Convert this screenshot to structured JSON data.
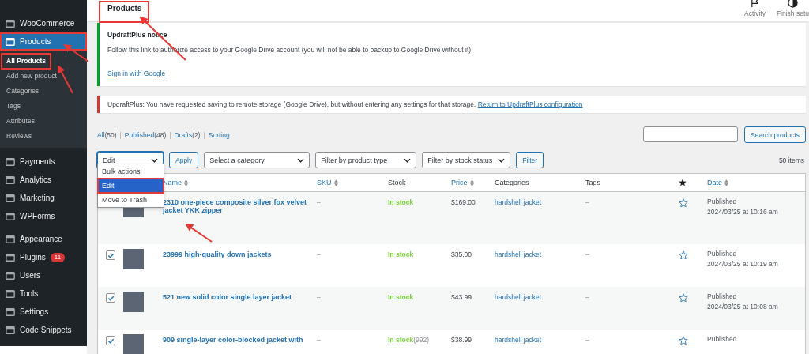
{
  "sidebar": {
    "groups": [
      {
        "items": [
          {
            "label": "WooCommerce",
            "selected": false,
            "annotated": false
          },
          {
            "label": "Products",
            "selected": true,
            "annotated": true,
            "children": [
              {
                "label": "All Products",
                "selected": true,
                "annotated": true
              },
              {
                "label": "Add new product",
                "selected": false,
                "annotated": false
              },
              {
                "label": "Categories",
                "selected": false,
                "annotated": false
              },
              {
                "label": "Tags",
                "selected": false,
                "annotated": false
              },
              {
                "label": "Attributes",
                "selected": false,
                "annotated": false
              },
              {
                "label": "Reviews",
                "selected": false,
                "annotated": false
              }
            ]
          }
        ]
      },
      {
        "items": [
          {
            "label": "Payments",
            "selected": false,
            "annotated": false
          },
          {
            "label": "Analytics",
            "selected": false,
            "annotated": false
          },
          {
            "label": "Marketing",
            "selected": false,
            "annotated": false
          },
          {
            "label": "WPForms",
            "selected": false,
            "annotated": false
          }
        ]
      },
      {
        "items": [
          {
            "label": "Appearance",
            "selected": false,
            "annotated": false
          },
          {
            "label": "Plugins",
            "selected": false,
            "annotated": false,
            "badge": "11"
          },
          {
            "label": "Users",
            "selected": false,
            "annotated": false
          },
          {
            "label": "Tools",
            "selected": false,
            "annotated": false
          },
          {
            "label": "Settings",
            "selected": false,
            "annotated": false
          },
          {
            "label": "Code Snippets",
            "selected": false,
            "annotated": false
          }
        ]
      }
    ]
  },
  "header": {
    "title": "Products",
    "title_annotated": true,
    "actions": [
      "Activity",
      "Finish setu"
    ]
  },
  "notices": [
    {
      "kind": "success",
      "title": "UpdraftPlus notice",
      "text": "Follow this link to authorize access to your Google Drive account (you will not be able to backup to Google Drive without it).",
      "link": "Sign in with Google"
    },
    {
      "kind": "error",
      "text": "UpdraftPlus: You have requested saving to remote storage (Google Drive), but without entering any settings for that storage.",
      "link": "Return to UpdraftPlus configuration"
    }
  ],
  "views": [
    {
      "label": "All",
      "count": "(50)"
    },
    {
      "separator_before": "|",
      "label": "Published",
      "count": "(48)"
    },
    {
      "separator_before": "|",
      "label": "Drafts",
      "count": "(2)"
    },
    {
      "separator_before": "|",
      "label": "Sorting"
    }
  ],
  "search": {
    "button": "Search products"
  },
  "filters": {
    "bulk_action": "Edit",
    "apply": "Apply",
    "selects": [
      "Select a category",
      "Filter by product type",
      "Filter by stock status"
    ],
    "filter_button": "Filter",
    "count": "50 items"
  },
  "bulk_menu": {
    "options": [
      {
        "label": "Bulk actions",
        "selected": false,
        "annotated": false
      },
      {
        "label": "Edit",
        "selected": true,
        "annotated": true
      },
      {
        "label": "Move to Trash",
        "selected": false,
        "annotated": false
      }
    ]
  },
  "table": {
    "columns": [
      "Name",
      "SKU",
      "Stock",
      "Price",
      "Categories",
      "Tags",
      "Date"
    ],
    "rows": [
      {
        "name": "2310 one-piece composite silver fox velvet jacket YKK zipper",
        "sku": "–",
        "stock": "In stock",
        "stock_count": "",
        "price": "$169.00",
        "category": "hardshell jacket",
        "tags": "–",
        "featured": false,
        "status": "Published",
        "date": "2024/03/25 at 10:16 am"
      },
      {
        "checked": true,
        "name": "23999 high-quality down jackets",
        "sku": "–",
        "stock": "In stock",
        "stock_count": "",
        "price": "$35.00",
        "category": "hardshell jacket",
        "tags": "–",
        "featured": false,
        "status": "Published",
        "date": "2024/03/25 at 10:19 am"
      },
      {
        "checked": true,
        "name": "521 new solid color single layer jacket",
        "sku": "–",
        "stock": "In stock",
        "stock_count": "",
        "price": "$43.99",
        "category": "hardshell jacket",
        "tags": "–",
        "featured": false,
        "status": "Published",
        "date": "2024/03/25 at 10:08 am"
      },
      {
        "checked": true,
        "name": "909 single-layer color-blocked jacket with",
        "sku": "–",
        "stock": "In stock",
        "stock_count": "(992)",
        "price": "$38.99",
        "category": "hardshell jacket",
        "tags": "–",
        "featured": false,
        "status": "Published",
        "date": ""
      }
    ]
  }
}
